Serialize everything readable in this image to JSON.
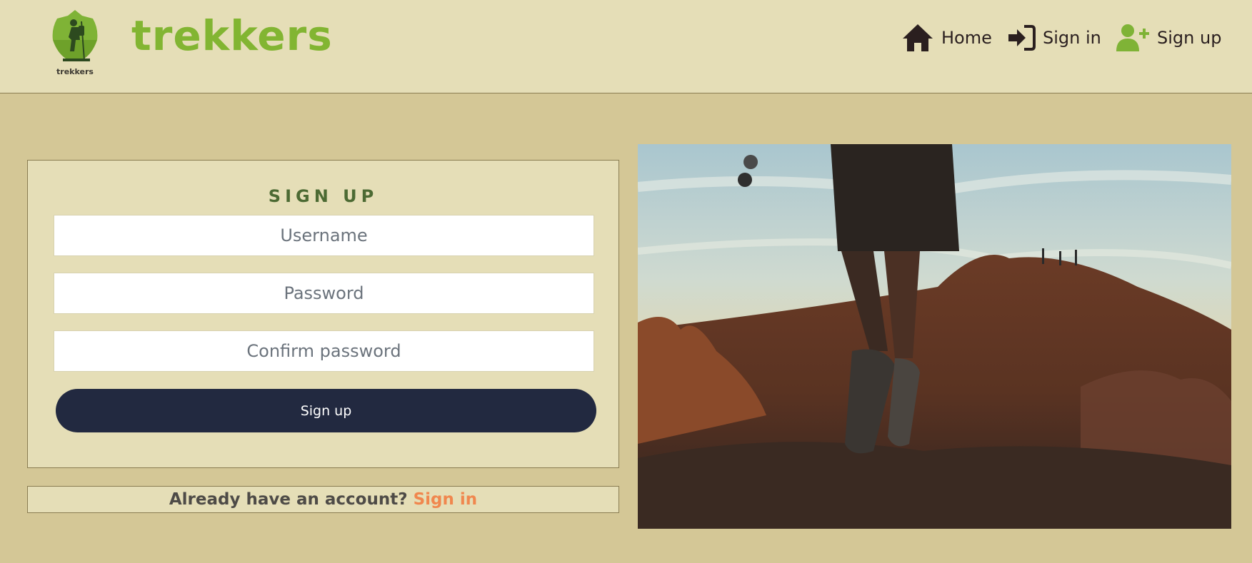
{
  "brand": {
    "logo_caption": "trekkers",
    "name": "trekkers"
  },
  "nav": {
    "home": "Home",
    "sign_in": "Sign in",
    "sign_up": "Sign up"
  },
  "form": {
    "title": "SIGN UP",
    "username_placeholder": "Username",
    "password_placeholder": "Password",
    "confirm_placeholder": "Confirm password",
    "submit_label": "Sign up"
  },
  "footer_prompt": {
    "text": "Already have an account?",
    "link": "Sign in"
  },
  "colors": {
    "accent_green": "#82b532",
    "button_navy": "#222940",
    "link_orange": "#f0874e",
    "page_bg": "#d4c796",
    "panel_bg": "#e5deb7"
  },
  "icons": [
    "home-icon",
    "sign-in-icon",
    "user-plus-icon"
  ]
}
